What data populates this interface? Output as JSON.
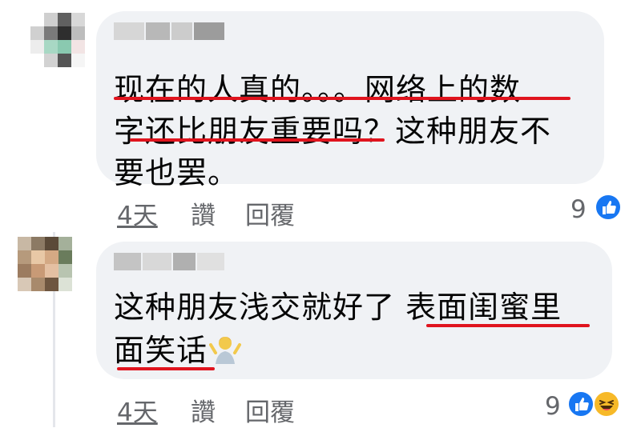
{
  "comments": [
    {
      "author": "",
      "lines": [
        "现在的人真的。。。网络上的数",
        "字还比朋友重要吗？这种朋友不",
        "要也罢。"
      ],
      "time": "4天",
      "like_label": "讚",
      "reply_label": "回覆",
      "reaction_count": "9",
      "reactions": [
        "like-icon"
      ]
    },
    {
      "author": "",
      "lines": [
        "这种朋友浅交就好了 表面闺蜜里",
        "面笑话"
      ],
      "emoji": "person-shrugging-icon",
      "time": "4天",
      "like_label": "讚",
      "reply_label": "回覆",
      "reaction_count": "9",
      "reactions": [
        "like-icon",
        "haha-icon"
      ]
    }
  ],
  "colors": {
    "bubble": "#f0f2f5",
    "underline": "#e0141e",
    "meta_text": "#65676b",
    "like_blue": "#1877f2",
    "haha_yellow": "#f7b928"
  }
}
